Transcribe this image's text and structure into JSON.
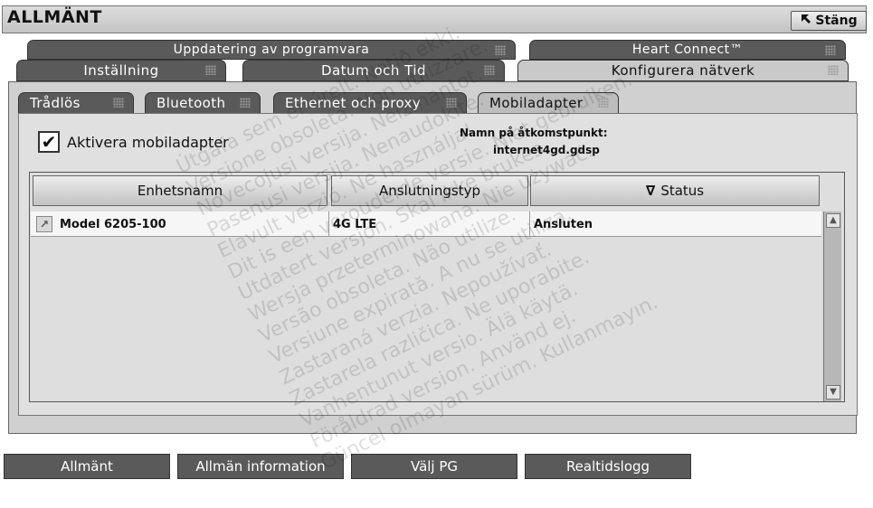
{
  "window": {
    "title": "ALLMÄNT",
    "close_label": "Stäng"
  },
  "tabs_row1": [
    {
      "label": "Uppdatering av programvara"
    },
    {
      "label": "Heart Connect™"
    }
  ],
  "tabs_row2": [
    {
      "label": "Inställning"
    },
    {
      "label": "Datum och Tid"
    },
    {
      "label": "Konfigurera nätverk",
      "active": true
    }
  ],
  "subtabs": [
    {
      "label": "Trådlös"
    },
    {
      "label": "Bluetooth"
    },
    {
      "label": "Ethernet och proxy"
    },
    {
      "label": "Mobiladapter",
      "active": true
    }
  ],
  "mobile": {
    "enable_label": "Aktivera mobiladapter",
    "enable_checked": "✔",
    "apn_label": "Namn på åtkomstpunkt:",
    "apn_value": "internet4gd.gdsp"
  },
  "table": {
    "columns": [
      {
        "label": "Enhetsnamn"
      },
      {
        "label": "Anslutningstyp"
      },
      {
        "label": "Status",
        "sort": "∇"
      }
    ],
    "rows": [
      {
        "name": "Model 6205-100",
        "type": "4G LTE",
        "status": "Ansluten"
      }
    ]
  },
  "bottom_tabs": [
    {
      "label": "Allmänt"
    },
    {
      "label": "Allmän information"
    },
    {
      "label": "Välj PG"
    },
    {
      "label": "Realtidslogg"
    }
  ],
  "watermark": [
    "Útgáfa sem er úrelt. Notið ekki.",
    "Versione obsoleta. Non utilizzare.",
    "Novecojusi versija. Neizmantot.",
    "Pasenusi versija. Nenaudokite.",
    "Elavult verzió. Ne használja!",
    "Dit is een verouderde versie. Niet gebruiken.",
    "Utdatert versjon. Skal ikke brukes.",
    "Wersja przeterminowana. Nie używać.",
    "Versão obsoleta. Não utilize.",
    "Versiune expirată. A nu se utiliza.",
    "Zastaraná verzia. Nepoužívať.",
    "Zastarela različica. Ne uporabite.",
    "Vanhentunut versio. Älä käytä.",
    "Föråldrad version. Använd ej.",
    "Güncel olmayan sürüm. Kullanmayın."
  ]
}
